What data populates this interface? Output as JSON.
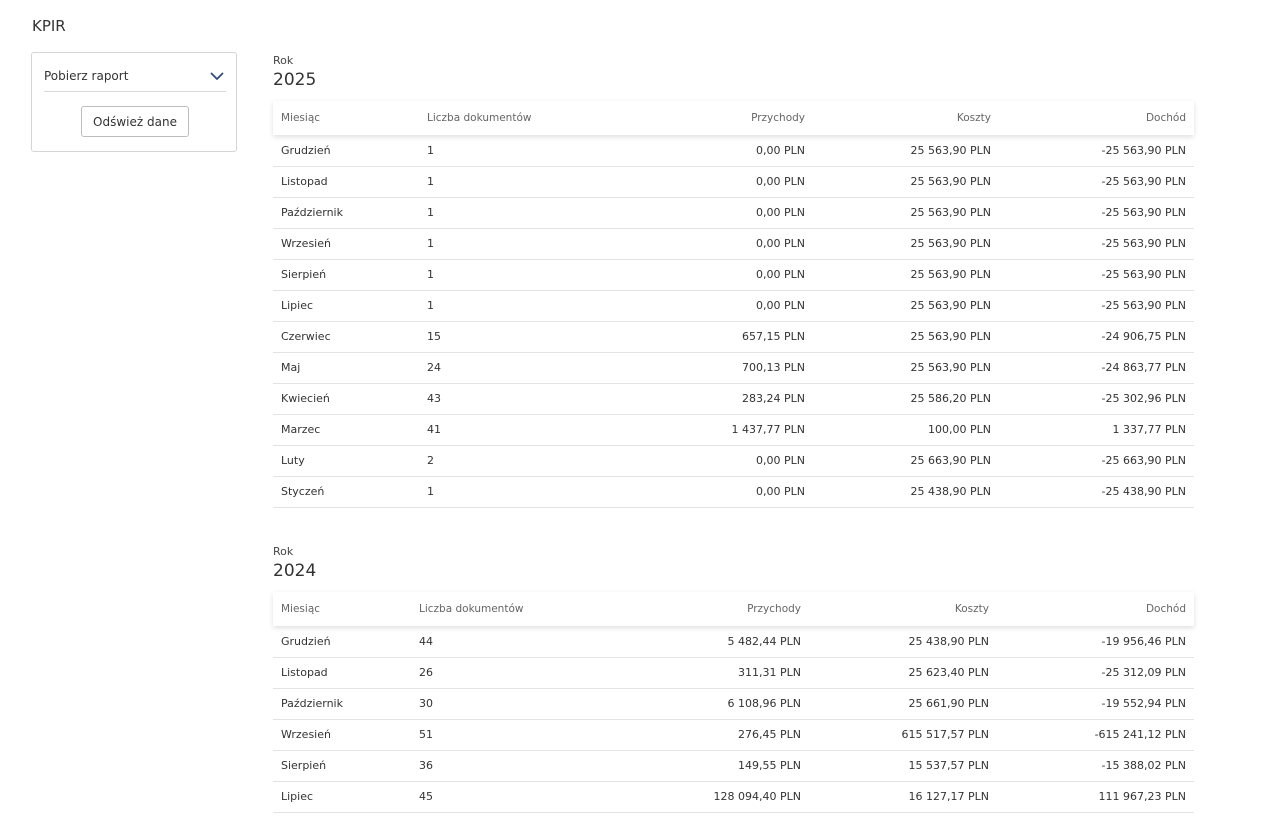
{
  "page": {
    "title": "KPIR"
  },
  "sidebar": {
    "dropdown_label": "Pobierz raport",
    "refresh_label": "Odśwież dane"
  },
  "table_headers": {
    "month": "Miesiąc",
    "docs": "Liczba dokumentów",
    "income": "Przychody",
    "costs": "Koszty",
    "profit": "Dochód"
  },
  "years": [
    {
      "label": "Rok",
      "year": "2025",
      "rows": [
        {
          "month": "Grudzień",
          "docs": "1",
          "income": "0,00 PLN",
          "costs": "25 563,90 PLN",
          "profit": "-25 563,90 PLN"
        },
        {
          "month": "Listopad",
          "docs": "1",
          "income": "0,00 PLN",
          "costs": "25 563,90 PLN",
          "profit": "-25 563,90 PLN"
        },
        {
          "month": "Październik",
          "docs": "1",
          "income": "0,00 PLN",
          "costs": "25 563,90 PLN",
          "profit": "-25 563,90 PLN"
        },
        {
          "month": "Wrzesień",
          "docs": "1",
          "income": "0,00 PLN",
          "costs": "25 563,90 PLN",
          "profit": "-25 563,90 PLN"
        },
        {
          "month": "Sierpień",
          "docs": "1",
          "income": "0,00 PLN",
          "costs": "25 563,90 PLN",
          "profit": "-25 563,90 PLN"
        },
        {
          "month": "Lipiec",
          "docs": "1",
          "income": "0,00 PLN",
          "costs": "25 563,90 PLN",
          "profit": "-25 563,90 PLN"
        },
        {
          "month": "Czerwiec",
          "docs": "15",
          "income": "657,15 PLN",
          "costs": "25 563,90 PLN",
          "profit": "-24 906,75 PLN"
        },
        {
          "month": "Maj",
          "docs": "24",
          "income": "700,13 PLN",
          "costs": "25 563,90 PLN",
          "profit": "-24 863,77 PLN"
        },
        {
          "month": "Kwiecień",
          "docs": "43",
          "income": "283,24 PLN",
          "costs": "25 586,20 PLN",
          "profit": "-25 302,96 PLN"
        },
        {
          "month": "Marzec",
          "docs": "41",
          "income": "1 437,77 PLN",
          "costs": "100,00 PLN",
          "profit": "1 337,77 PLN"
        },
        {
          "month": "Luty",
          "docs": "2",
          "income": "0,00 PLN",
          "costs": "25 663,90 PLN",
          "profit": "-25 663,90 PLN"
        },
        {
          "month": "Styczeń",
          "docs": "1",
          "income": "0,00 PLN",
          "costs": "25 438,90 PLN",
          "profit": "-25 438,90 PLN"
        }
      ]
    },
    {
      "label": "Rok",
      "year": "2024",
      "rows": [
        {
          "month": "Grudzień",
          "docs": "44",
          "income": "5 482,44 PLN",
          "costs": "25 438,90 PLN",
          "profit": "-19 956,46 PLN"
        },
        {
          "month": "Listopad",
          "docs": "26",
          "income": "311,31 PLN",
          "costs": "25 623,40 PLN",
          "profit": "-25 312,09 PLN"
        },
        {
          "month": "Październik",
          "docs": "30",
          "income": "6 108,96 PLN",
          "costs": "25 661,90 PLN",
          "profit": "-19 552,94 PLN"
        },
        {
          "month": "Wrzesień",
          "docs": "51",
          "income": "276,45 PLN",
          "costs": "615 517,57 PLN",
          "profit": "-615 241,12 PLN"
        },
        {
          "month": "Sierpień",
          "docs": "36",
          "income": "149,55 PLN",
          "costs": "15 537,57 PLN",
          "profit": "-15 388,02 PLN"
        },
        {
          "month": "Lipiec",
          "docs": "45",
          "income": "128 094,40 PLN",
          "costs": "16 127,17 PLN",
          "profit": "111 967,23 PLN"
        }
      ]
    }
  ]
}
